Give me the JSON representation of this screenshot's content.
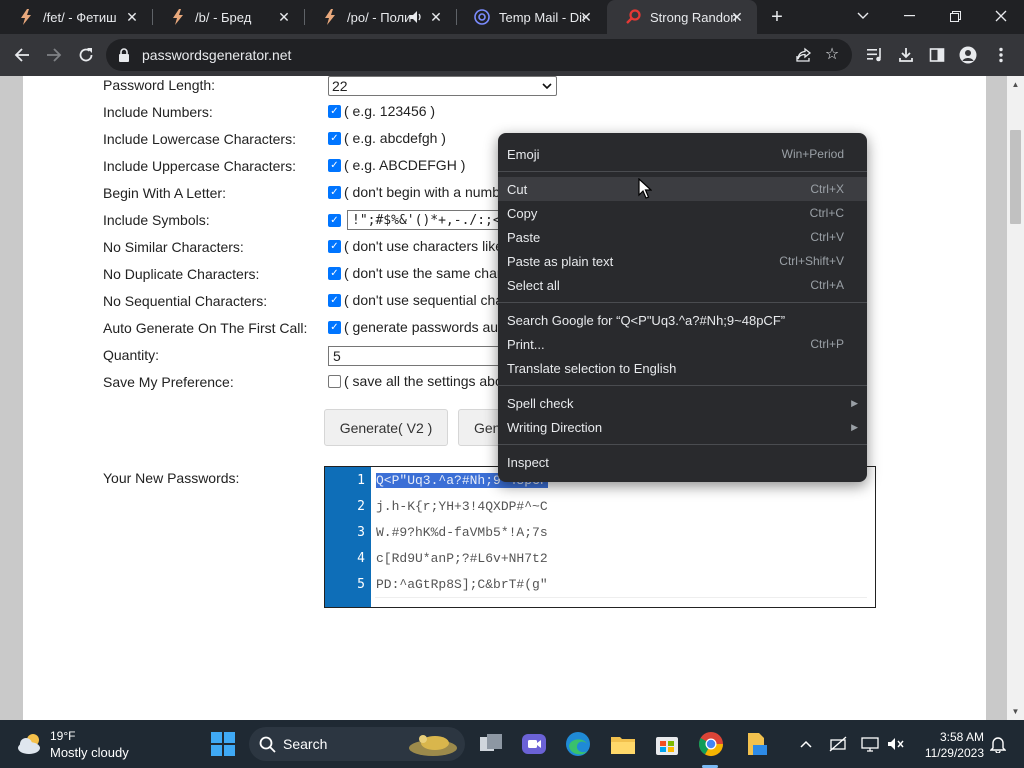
{
  "browser": {
    "tabs": [
      {
        "title": "/fet/ - Фетиш",
        "active": false
      },
      {
        "title": "/b/ - Бред",
        "active": false
      },
      {
        "title": "/po/ - Поли",
        "active": false
      },
      {
        "title": "Temp Mail - Dis",
        "active": false
      },
      {
        "title": "Strong Random",
        "active": true
      }
    ],
    "url": "passwordsgenerator.net"
  },
  "form": {
    "rows": [
      {
        "label": "Password Length:",
        "kind": "select",
        "value": "22"
      },
      {
        "label": "Include Numbers:",
        "kind": "check",
        "checked": true,
        "hint": "( e.g. 123456 )"
      },
      {
        "label": "Include Lowercase Characters:",
        "kind": "check",
        "checked": true,
        "hint": "( e.g. abcdefgh )"
      },
      {
        "label": "Include Uppercase Characters:",
        "kind": "check",
        "checked": true,
        "hint": "( e.g. ABCDEFGH )"
      },
      {
        "label": "Begin With A Letter:",
        "kind": "check",
        "checked": true,
        "hint": "( don't begin with a numb"
      },
      {
        "label": "Include Symbols:",
        "kind": "symbols",
        "checked": true,
        "value": "!\";#$%&'()*+,-./:;<"
      },
      {
        "label": "No Similar Characters:",
        "kind": "check",
        "checked": true,
        "hint": "( don't use characters like"
      },
      {
        "label": "No Duplicate Characters:",
        "kind": "check",
        "checked": true,
        "hint": "( don't use the same char"
      },
      {
        "label": "No Sequential Characters:",
        "kind": "check",
        "checked": true,
        "hint": "( don't use sequential cha"
      },
      {
        "label": "Auto Generate On The First Call:",
        "kind": "check",
        "checked": true,
        "hint": "( generate passwords aut"
      },
      {
        "label": "Quantity:",
        "kind": "text",
        "value": "5"
      },
      {
        "label": "Save My Preference:",
        "kind": "check",
        "checked": false,
        "hint": "( save all the settings abo"
      }
    ],
    "generate_v2_label": "Generate( V2 )",
    "generate_label": "Gen",
    "output_label": "Your New Passwords:"
  },
  "passwords": [
    {
      "n": "1",
      "text": "Q<P\"Uq3.^a?#Nh;9~48pCF",
      "selected": true
    },
    {
      "n": "2",
      "text": "j.h-K{r;YH+3!4QXDP#^~C",
      "selected": false
    },
    {
      "n": "3",
      "text": "W.#9?hK%d-faVMb5*!A;7s",
      "selected": false
    },
    {
      "n": "4",
      "text": "c[Rd9U*anP;?#L6v+NH7t2",
      "selected": false
    },
    {
      "n": "5",
      "text": "PD:^aGtRp8S];C&brT#(g\"",
      "selected": false
    }
  ],
  "context_menu": {
    "items": [
      {
        "label": "Emoji",
        "shortcut": "Win+Period"
      },
      {
        "label": "Cut",
        "shortcut": "Ctrl+X",
        "hover": true
      },
      {
        "label": "Copy",
        "shortcut": "Ctrl+C"
      },
      {
        "label": "Paste",
        "shortcut": "Ctrl+V"
      },
      {
        "label": "Paste as plain text",
        "shortcut": "Ctrl+Shift+V"
      },
      {
        "label": "Select all",
        "shortcut": "Ctrl+A"
      },
      {
        "label": "Search Google for “Q<P\"Uq3.^a?#Nh;9~48pCF”",
        "shortcut": ""
      },
      {
        "label": "Print...",
        "shortcut": "Ctrl+P"
      },
      {
        "label": "Translate selection to English",
        "shortcut": ""
      },
      {
        "label": "Spell check",
        "shortcut": "",
        "submenu": true
      },
      {
        "label": "Writing Direction",
        "shortcut": "",
        "submenu": true
      },
      {
        "label": "Inspect",
        "shortcut": ""
      }
    ]
  },
  "taskbar": {
    "weather_temp": "19°F",
    "weather_cond": "Mostly cloudy",
    "search_label": "Search",
    "time": "3:58 AM",
    "date": "11/29/2023"
  }
}
